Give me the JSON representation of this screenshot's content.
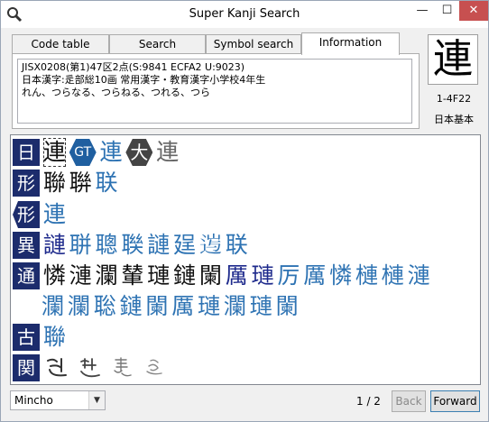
{
  "window": {
    "title": "Super Kanji Search",
    "minimize_glyph": "—",
    "maximize_glyph": "☐",
    "close_glyph": "✕"
  },
  "tabs": [
    {
      "label": "Code table"
    },
    {
      "label": "Search"
    },
    {
      "label": "Symbol search"
    },
    {
      "label": "Information"
    }
  ],
  "info": {
    "line1": "JISX0208(第1)47区2点(S:9841  ECFA2  U:9023)",
    "line2": "日本漢字:辵部総10画  常用漢字・教育漢字小学校4年生",
    "line3": "れん、つらなる、つらねる、つれる、つら"
  },
  "kanji_card": {
    "char": "連",
    "code": "1-4F22",
    "type": "日本基本"
  },
  "results": {
    "row_ri": {
      "badge": "日",
      "items": [
        "連",
        "GT",
        "連",
        "大",
        "連"
      ]
    },
    "row_kei": {
      "badge": "形",
      "items": [
        "聯",
        "聨",
        "联"
      ]
    },
    "row_kei2": {
      "badge": "形",
      "items": [
        "連"
      ]
    },
    "row_i": {
      "badge": "異",
      "items": [
        "謰",
        "聠",
        "聰",
        "聫",
        "謰",
        "𢌥",
        "𨓂",
        "联"
      ]
    },
    "row_tsu": {
      "badge": "通",
      "items": [
        "憐",
        "漣",
        "瀾",
        "輦",
        "璉",
        "鏈",
        "闌",
        "厲",
        "璉",
        "厉",
        "厲",
        "憐",
        "槤",
        "槤",
        "漣"
      ]
    },
    "row_tsu_cont": {
      "items": [
        "瀾",
        "瀾",
        "聡",
        "鏈",
        "闌",
        "厲",
        "璉",
        "瀾",
        "璉",
        "闌"
      ]
    },
    "row_ko": {
      "badge": "古",
      "items": [
        "聯"
      ]
    },
    "row_kan": {
      "badge": "関",
      "hand_icons": [
        "cursive-ren-1-icon",
        "cursive-ren-2-icon",
        "cursive-ren-3-icon",
        "cursive-ren-4-icon"
      ]
    }
  },
  "bottom": {
    "font_value": "Mincho",
    "page": "1 / 2",
    "back_label": "Back",
    "forward_label": "Forward"
  },
  "colors": {
    "badge_bg": "#1c2c6c",
    "blue_kanji": "#2e73b3",
    "dark_kanji": "#1e2a8c",
    "close_button": "#c75050"
  }
}
